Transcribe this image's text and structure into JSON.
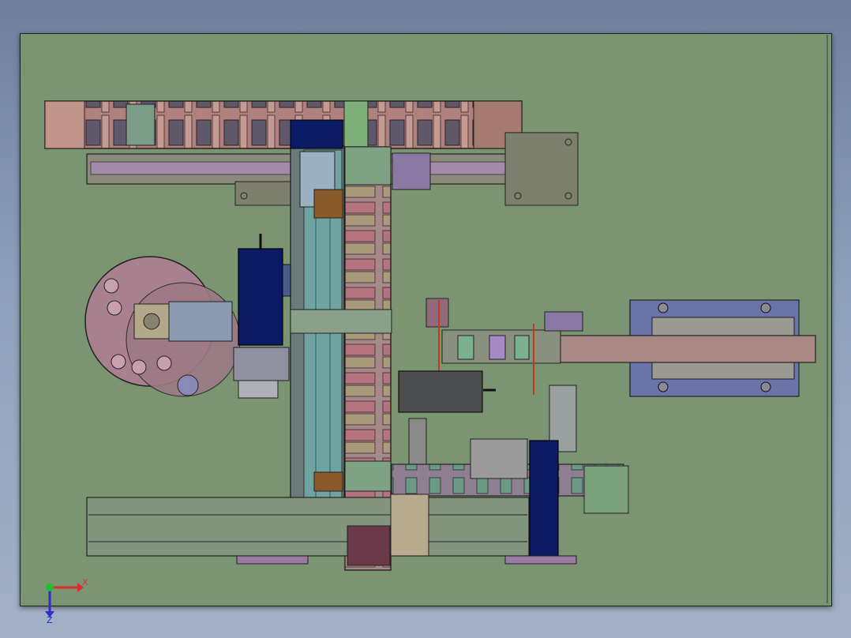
{
  "view": {
    "background_top": "#6f7f9b",
    "sheet_color": "#7b9573"
  },
  "triad": {
    "x_label": "X",
    "z_label": "Z",
    "x_color": "#d83030",
    "z_color": "#2c2cc8",
    "origin_color": "#1fbf2f"
  },
  "colors": {
    "chain_pink": "#b98680",
    "chain_dark": "#5a5060",
    "rail_purple": "#9d8aa6",
    "motor_navy": "#0c1a66",
    "steel_teal": "#6fa3a1",
    "plate_grey": "#8c8a7a",
    "dial_pink": "#a8808e",
    "cylinder_grey": "#4b4d4e",
    "pad_blue": "#6a73a8",
    "green_block": "#79a07a",
    "bracket_brown": "#8a5a2a"
  }
}
